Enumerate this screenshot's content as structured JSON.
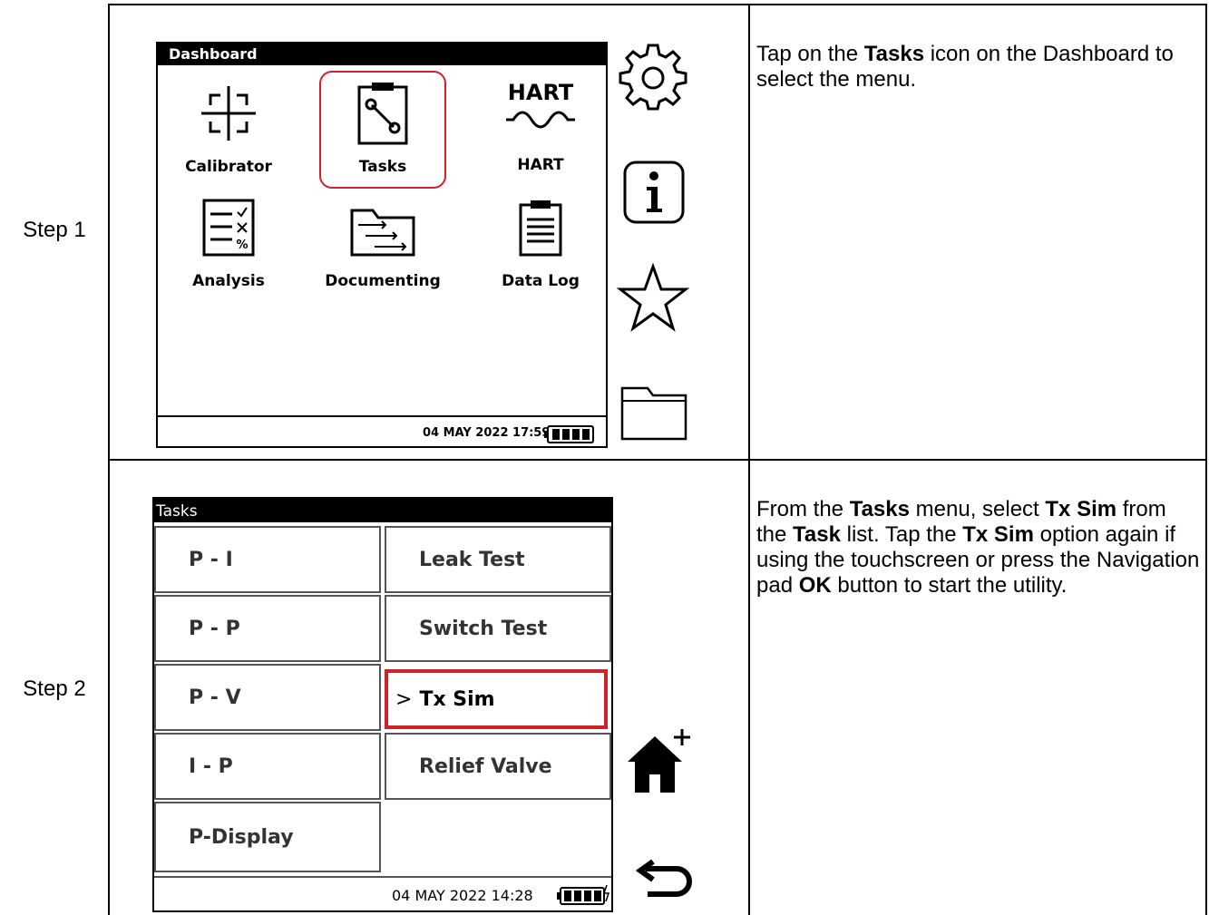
{
  "rows": [
    {
      "step_label": "Step 1",
      "description": [
        {
          "text": "Tap on the ",
          "bold": false
        },
        {
          "text": "Tasks",
          "bold": true
        },
        {
          "text": " icon on the Dashboard to select the menu.",
          "bold": false
        }
      ]
    },
    {
      "step_label": "Step 2",
      "description": [
        {
          "text": "From the ",
          "bold": false
        },
        {
          "text": "Tasks",
          "bold": true
        },
        {
          "text": " menu, select ",
          "bold": false
        },
        {
          "text": "Tx Sim",
          "bold": true
        },
        {
          "text": " from the ",
          "bold": false
        },
        {
          "text": "Task",
          "bold": true
        },
        {
          "text": " list. Tap the ",
          "bold": false
        },
        {
          "text": "Tx Sim",
          "bold": true
        },
        {
          "text": " option again if using the touchscreen or press the Navigation pad ",
          "bold": false
        },
        {
          "text": "OK",
          "bold": true
        },
        {
          "text": " button to start the utility.",
          "bold": false
        }
      ]
    }
  ],
  "dashboard": {
    "title": "Dashboard",
    "tiles": {
      "calibrator": "Calibrator",
      "tasks": "Tasks",
      "hart_logo": "HART",
      "hart": "HART",
      "analysis": "Analysis",
      "documenting": "Documenting",
      "data_log": "Data Log"
    },
    "status": "04 MAY 2022 17:59",
    "highlight_color": "#d0202a",
    "side_icons": [
      "gear-icon",
      "info-icon",
      "star-icon",
      "folder-icon"
    ]
  },
  "tasks_screen": {
    "title": "Tasks",
    "left": [
      "P - I",
      "P - P",
      "P - V",
      "I - P",
      "P-Display"
    ],
    "right": [
      "Leak Test",
      "Switch Test",
      "Tx Sim",
      "Relief Valve"
    ],
    "selected_marker": ">",
    "status": "04 MAY 2022 14:28",
    "side_icons": [
      "home-plus-icon",
      "back-arrow-icon"
    ]
  }
}
